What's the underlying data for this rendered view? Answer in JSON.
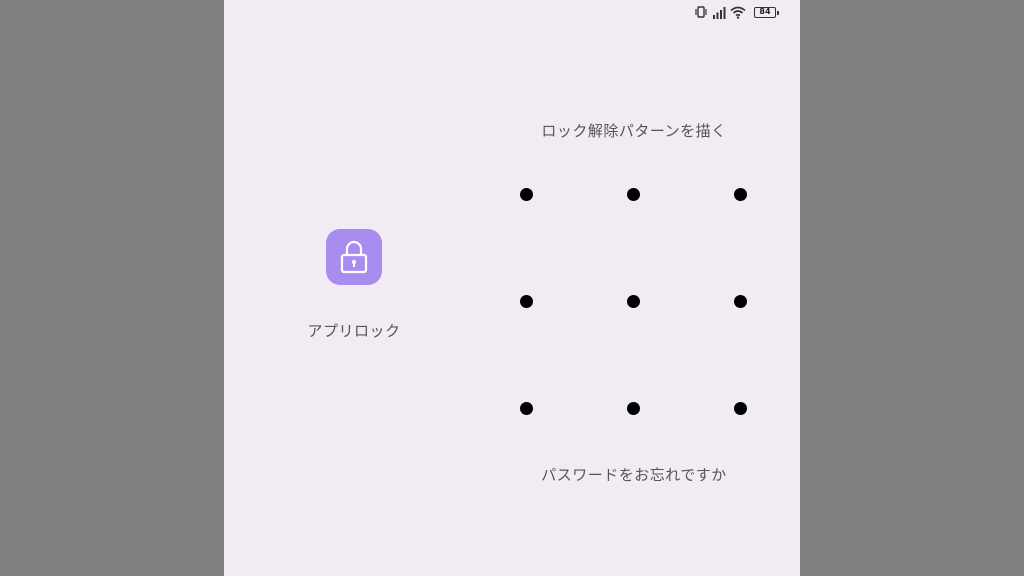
{
  "status_bar": {
    "battery_level": "84",
    "icons": [
      "vibrate-icon",
      "signal-icon",
      "wifi-icon",
      "battery-icon"
    ]
  },
  "app": {
    "name": "アプリロック",
    "icon": "lock-icon",
    "icon_color": "#a98cf0"
  },
  "pattern": {
    "prompt": "ロック解除パターンを描く",
    "forgot_link": "パスワードをお忘れですか",
    "dot_count": 9
  },
  "colors": {
    "background": "#f1ecf4",
    "dot": "#000000",
    "text": "#555555"
  }
}
